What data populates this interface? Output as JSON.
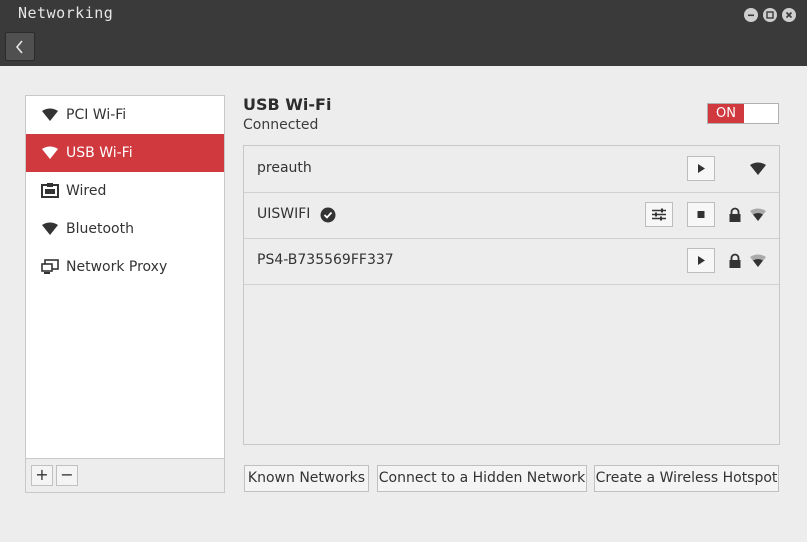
{
  "window": {
    "title": "Networking"
  },
  "sidebar": {
    "items": [
      {
        "label": "PCI Wi-Fi",
        "icon": "wifi-icon"
      },
      {
        "label": "USB Wi-Fi",
        "icon": "wifi-icon",
        "selected": true
      },
      {
        "label": "Wired",
        "icon": "wired-icon"
      },
      {
        "label": "Bluetooth",
        "icon": "wifi-icon"
      },
      {
        "label": "Network Proxy",
        "icon": "proxy-icon"
      }
    ],
    "add_label": "+",
    "remove_label": "−"
  },
  "device": {
    "name": "USB Wi-Fi",
    "status": "Connected",
    "toggle_label": "ON",
    "toggle_state": "on"
  },
  "networks": [
    {
      "ssid": "preauth",
      "connected": false,
      "secured": false,
      "action": "connect"
    },
    {
      "ssid": "UISWIFI",
      "connected": true,
      "secured": true,
      "action": "disconnect"
    },
    {
      "ssid": "PS4-B735569FF337",
      "connected": false,
      "secured": true,
      "action": "connect"
    }
  ],
  "buttons": {
    "known_networks": "Known Networks",
    "hidden_network": "Connect to a Hidden Network",
    "hotspot": "Create a Wireless Hotspot"
  },
  "colors": {
    "accent": "#d0393e",
    "titlebar": "#3a3a3a",
    "background": "#ededed"
  }
}
